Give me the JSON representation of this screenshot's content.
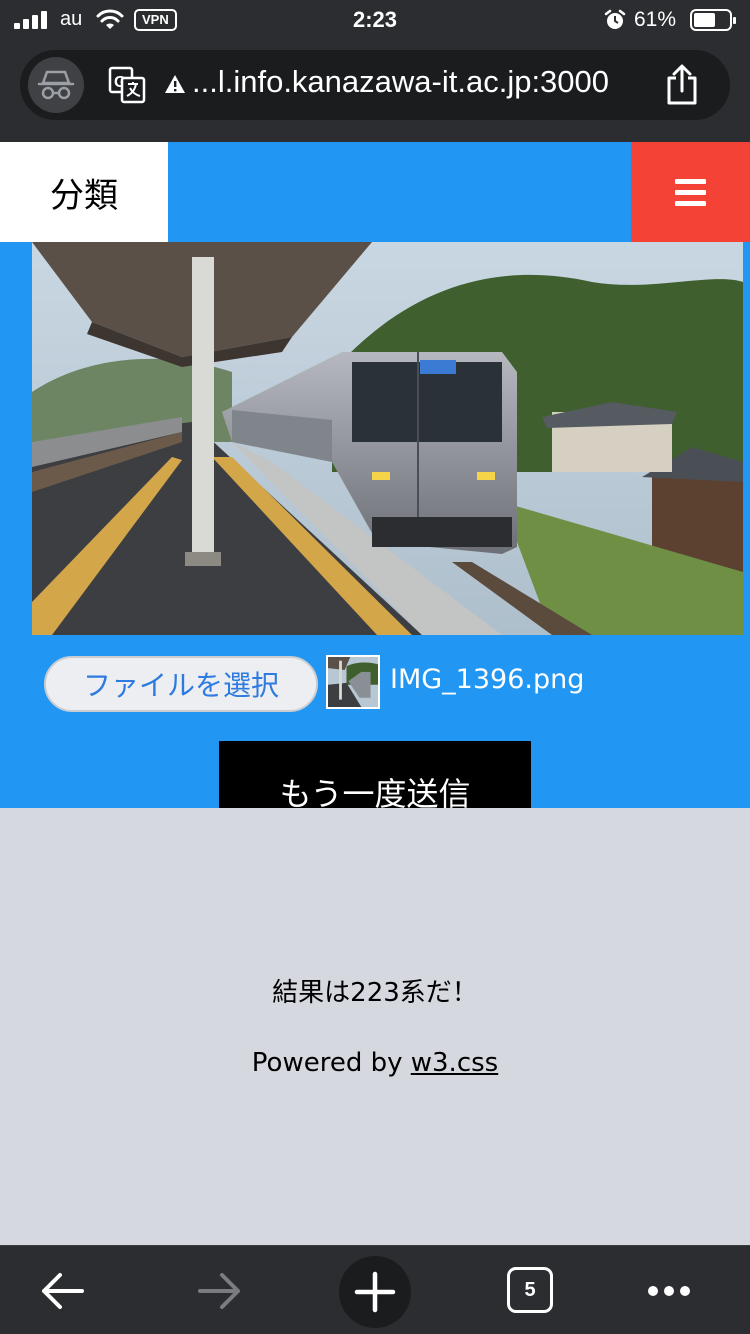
{
  "status_bar": {
    "carrier": "au",
    "vpn": "VPN",
    "time": "2:23",
    "battery_percent": "61%",
    "battery_level": 0.61
  },
  "browser": {
    "url": "...l.info.kanazawa-it.ac.jp:3000",
    "open_tabs": "5"
  },
  "nav": {
    "title": "分類"
  },
  "upload": {
    "choose_file_label": "ファイルを選択",
    "file_name": "IMG_1396.png",
    "submit_label": "もう一度送信"
  },
  "footer": {
    "result_text": "結果は223系だ！",
    "powered_prefix": "Powered by ",
    "powered_link": "w3.css"
  },
  "colors": {
    "page_blue": "#2196f3",
    "menu_red": "#f44336",
    "footer_gray": "#d5d8de",
    "chrome_dark": "#2b2d30"
  },
  "icons": [
    "signal-icon",
    "wifi-icon",
    "alarm-icon",
    "battery-icon",
    "incognito-icon",
    "translate-icon",
    "warning-icon",
    "share-icon",
    "hamburger-icon",
    "back-arrow-icon",
    "forward-arrow-icon",
    "plus-icon",
    "tabs-icon",
    "more-icon"
  ]
}
